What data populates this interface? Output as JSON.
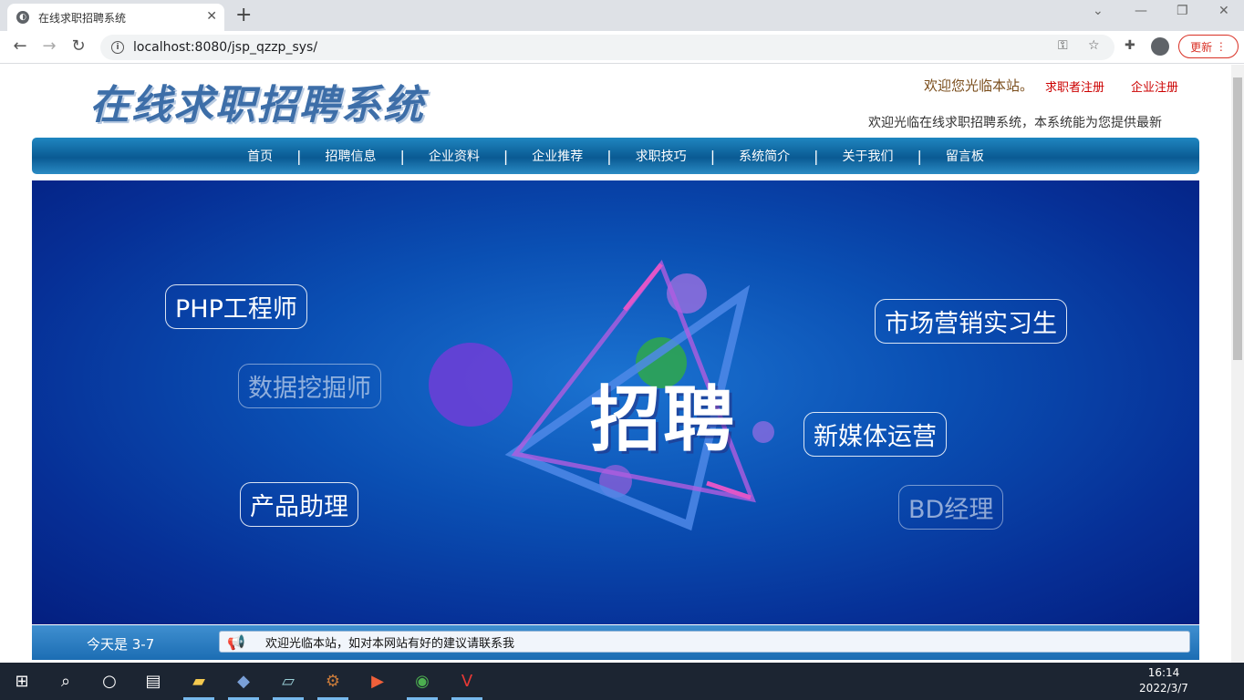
{
  "browser": {
    "tab_title": "在线求职招聘系统",
    "url": "localhost:8080/jsp_qzzp_sys/",
    "update_label": "更新"
  },
  "header": {
    "logo_text": "在线求职招聘系统",
    "welcome": "欢迎您光临本站。",
    "register_seeker": "求职者注册",
    "register_company": "企业注册",
    "marquee": "欢迎光临在线求职招聘系统，本系统能为您提供最新"
  },
  "nav": {
    "items": [
      {
        "label": "首页"
      },
      {
        "label": "招聘信息"
      },
      {
        "label": "企业资料"
      },
      {
        "label": "企业推荐"
      },
      {
        "label": "求职技巧"
      },
      {
        "label": "系统简介"
      },
      {
        "label": "关于我们"
      },
      {
        "label": "留言板"
      }
    ],
    "separator": "|"
  },
  "banner": {
    "center_text": "招聘",
    "jobs": [
      {
        "label": "PHP工程师"
      },
      {
        "label": "数据挖掘师"
      },
      {
        "label": "产品助理"
      },
      {
        "label": "市场营销实习生"
      },
      {
        "label": "新媒体运营"
      },
      {
        "label": "BD经理"
      }
    ]
  },
  "footer": {
    "today": "今天是 3-7",
    "notice": "欢迎光临本站，如对本网站有好的建议请联系我"
  },
  "taskbar": {
    "time": "16:14",
    "date": "2022/3/7"
  },
  "colors": {
    "nav_blue": "#0a5a93",
    "banner_blue": "#0a4fb3",
    "register_red": "#cc0000"
  }
}
